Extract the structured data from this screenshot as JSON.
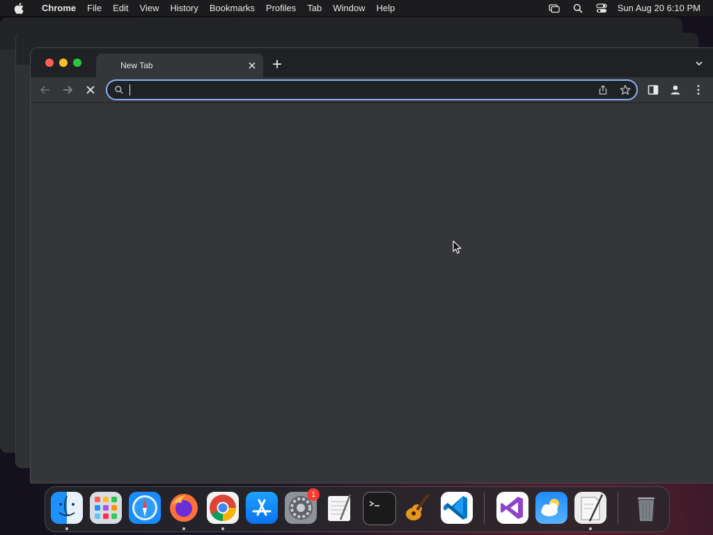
{
  "menubar": {
    "app_name": "Chrome",
    "items": [
      "File",
      "Edit",
      "View",
      "History",
      "Bookmarks",
      "Profiles",
      "Tab",
      "Window",
      "Help"
    ],
    "clock": "Sun Aug 20  6:10 PM"
  },
  "browser": {
    "tab_title": "New Tab",
    "omnibox_value": "",
    "state": "loading"
  },
  "dock": {
    "apps": [
      "finder-icon",
      "launchpad-icon",
      "safari-icon",
      "firefox-icon",
      "chrome-icon",
      "app-store-icon",
      "system-settings-icon",
      "textedit-icon",
      "terminal-icon",
      "garageband-icon",
      "vscode-icon",
      "visual-studio-icon",
      "weather-icon",
      "script-editor-icon",
      "trash-icon"
    ],
    "system_settings_badge": "1"
  },
  "colors": {
    "accent": "#8ab4f8",
    "window_bg": "#35363a",
    "tabstrip_bg": "#202124"
  }
}
